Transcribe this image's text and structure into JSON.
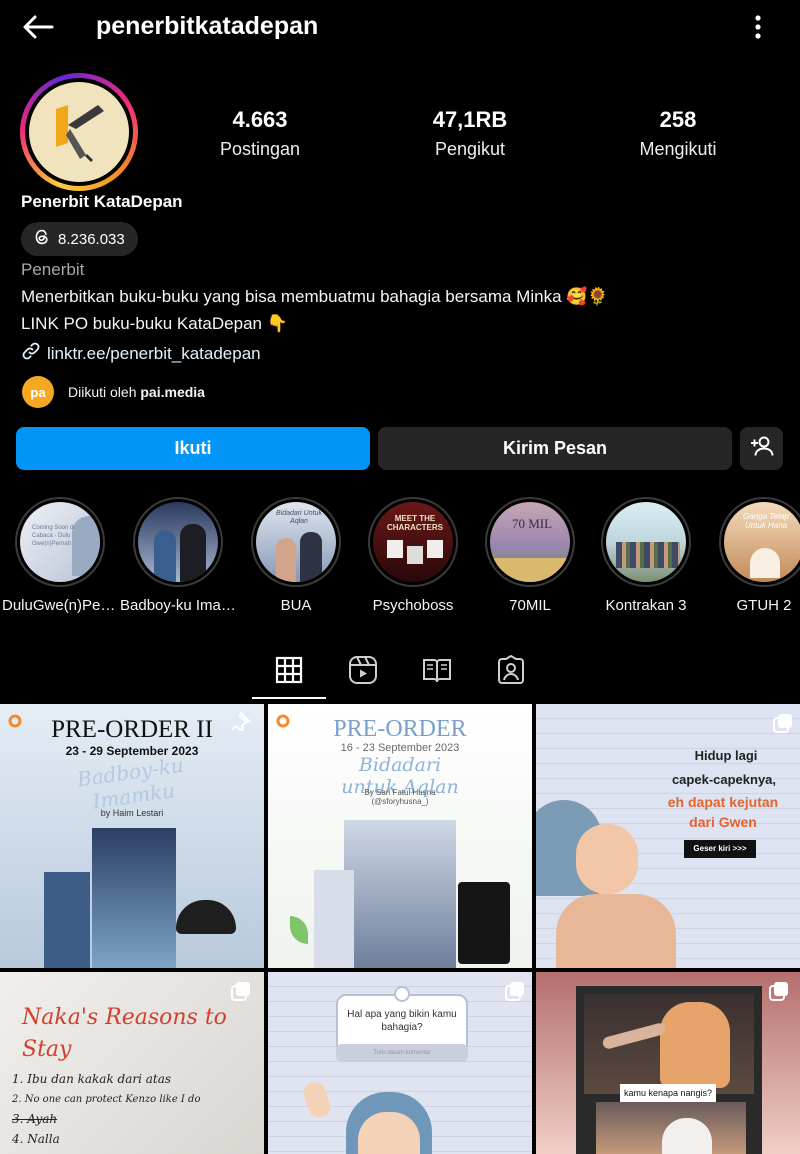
{
  "header": {
    "username": "penerbitkatadepan"
  },
  "stats": [
    {
      "value": "4.663",
      "label": "Postingan"
    },
    {
      "value": "47,1RB",
      "label": "Pengikut"
    },
    {
      "value": "258",
      "label": "Mengikuti"
    }
  ],
  "profile": {
    "display_name": "Penerbit KataDepan",
    "threads_count": "8.236.033",
    "category": "Penerbit",
    "bio": [
      "Menerbitkan buku-buku yang bisa membuatmu bahagia bersama Minka 🥰🌻",
      "LINK PO buku-buku KataDepan 👇"
    ],
    "link": "linktr.ee/penerbit_katadepan",
    "followed_by_prefix": "Diikuti oleh ",
    "followed_by_user": "pai.media",
    "followed_by_logo": "pa"
  },
  "buttons": {
    "follow": "Ikuti",
    "message": "Kirim Pesan"
  },
  "highlights": [
    {
      "label": "DuluGwe(n)Pernah",
      "text": "Coming Soon di Cabaca · Dulu Gwe(n)Pernah",
      "colors": [
        "#dfe4ef",
        "#9fb0c8"
      ]
    },
    {
      "label": "Badboy-ku Imamku",
      "text": "",
      "colors": [
        "#2e3f66",
        "#b9c7e0"
      ]
    },
    {
      "label": "BUA",
      "text": "Bidadari Untuk Aqlan",
      "colors": [
        "#cfd8e6",
        "#7e8eaa"
      ]
    },
    {
      "label": "Psychoboss",
      "text": "MEET THE CHARACTERS",
      "colors": [
        "#5c1414",
        "#2a0808"
      ]
    },
    {
      "label": "70MIL",
      "text": "70 MIL",
      "colors": [
        "#b99aa8",
        "#7e6a93"
      ]
    },
    {
      "label": "Kontrakan 3",
      "text": "",
      "colors": [
        "#cfe3ec",
        "#7a8f7c"
      ]
    },
    {
      "label": "GTUH 2",
      "text": "Ganga Tetap Untuk Hana",
      "colors": [
        "#f1d6b5",
        "#c6925d"
      ]
    }
  ],
  "tabs": [
    "grid-icon",
    "reels-icon",
    "guide-icon",
    "tagged-icon"
  ],
  "posts": [
    {
      "title": "PRE-ORDER II",
      "subtitle": "23 - 29 September 2023",
      "script": "Badboy-ku Imamku",
      "author": "by Haim Lestari",
      "bg": "#c9d7e6",
      "type": "reel"
    },
    {
      "title": "PRE-ORDER",
      "subtitle": "16 - 23 September 2023",
      "script": "Bidadari untuk Aqlan",
      "author": "By Sari Fatul Husna (@sforyhusna_)",
      "bg": "#f4f7f3",
      "type": "reel"
    },
    {
      "lines": [
        "Hidup lagi",
        "capek-capeknya,"
      ],
      "highlight": [
        "eh dapat kejutan",
        "dari Gwen"
      ],
      "cta": "Geser kiri >>>",
      "bg": "#d6dcec",
      "type": "carousel"
    },
    {
      "script": "Naka's Reasons to Stay",
      "lines": [
        "1. Ibu dan kakak dari atas",
        "2. No one can protect Kenzo like I do",
        "3. Ayah",
        "4. Nalla"
      ],
      "bg": "#e9e7e4",
      "type": "carousel"
    },
    {
      "bubble": "Hal apa yang bikin kamu bahagia?",
      "input": "Tulis dalam komentar",
      "bg": "#d9ddeb",
      "type": "carousel"
    },
    {
      "caption": "kamu kenapa nangis?",
      "bg": "#a86f70",
      "type": "carousel"
    }
  ]
}
